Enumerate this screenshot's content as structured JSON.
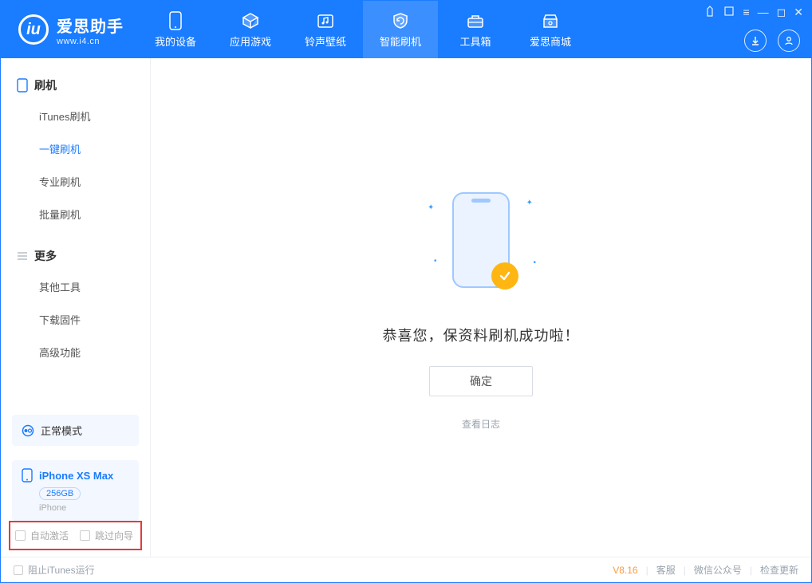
{
  "app": {
    "name": "爱思助手",
    "site": "www.i4.cn"
  },
  "window_controls": {
    "cloth": "⎘",
    "skin": "⏣",
    "menu": "≡",
    "min": "—",
    "max": "◻",
    "close": "✕"
  },
  "header_icons": {
    "download": "download-icon",
    "account": "account-icon"
  },
  "tabs": [
    {
      "label": "我的设备",
      "icon": "device-icon"
    },
    {
      "label": "应用游戏",
      "icon": "cube-icon"
    },
    {
      "label": "铃声壁纸",
      "icon": "music-folder-icon"
    },
    {
      "label": "智能刷机",
      "icon": "refresh-shield-icon",
      "active": true
    },
    {
      "label": "工具箱",
      "icon": "toolbox-icon"
    },
    {
      "label": "爱思商城",
      "icon": "shop-icon"
    }
  ],
  "sidebar": {
    "group1_title": "刷机",
    "group1": [
      {
        "label": "iTunes刷机"
      },
      {
        "label": "一键刷机",
        "active": true
      },
      {
        "label": "专业刷机"
      },
      {
        "label": "批量刷机"
      }
    ],
    "group2_title": "更多",
    "group2": [
      {
        "label": "其他工具"
      },
      {
        "label": "下载固件"
      },
      {
        "label": "高级功能"
      }
    ]
  },
  "device": {
    "mode_label": "正常模式",
    "name": "iPhone XS Max",
    "capacity": "256GB",
    "type": "iPhone"
  },
  "checkboxes": {
    "auto_activate": "自动激活",
    "skip_guide": "跳过向导"
  },
  "main": {
    "success_msg": "恭喜您，保资料刷机成功啦！",
    "ok_button": "确定",
    "view_log": "查看日志"
  },
  "statusbar": {
    "block_itunes": "阻止iTunes运行",
    "version": "V8.16",
    "links": {
      "service": "客服",
      "wechat": "微信公众号",
      "update": "检查更新"
    }
  }
}
